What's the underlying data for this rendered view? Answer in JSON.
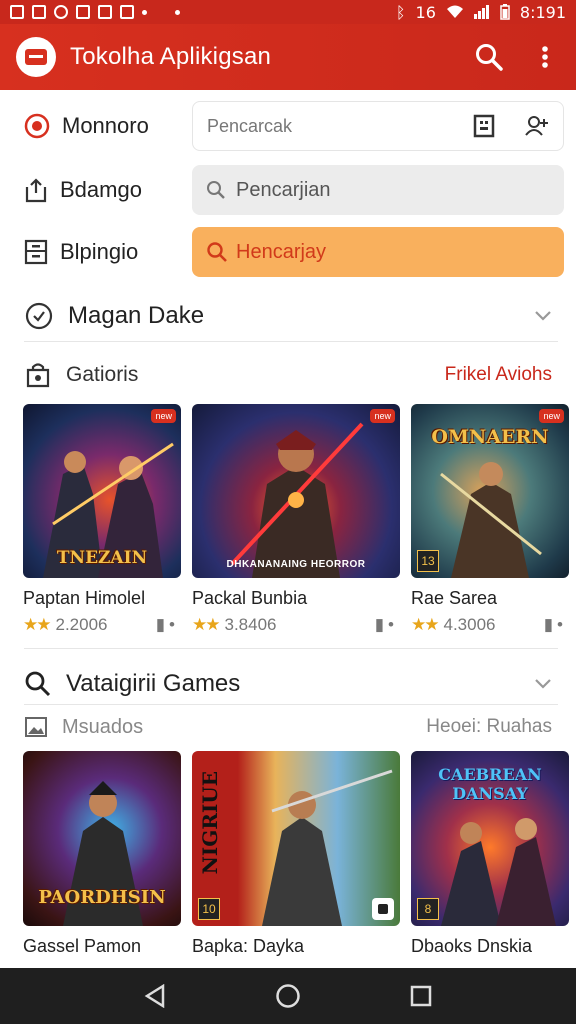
{
  "status_bar": {
    "time": "8:191",
    "network": "16"
  },
  "app_bar": {
    "title": "Tokolha Aplikigsan"
  },
  "filters": [
    {
      "label": "Monnoro",
      "field_text": "Pencarcak"
    },
    {
      "label": "Bdamgo",
      "field_text": "Pencarjian"
    },
    {
      "label": "Blpingio",
      "field_text": "Hencarjay"
    }
  ],
  "section1": {
    "title": "Magan Dake"
  },
  "section2": {
    "title": "Gatioris",
    "link": "Frikel Aviohs"
  },
  "cards_row1": [
    {
      "title": "Paptan Himolel",
      "rating": "2.2006",
      "caption": "TNEZAIN",
      "badge": "new"
    },
    {
      "title": "Packal Bunbia",
      "rating": "3.8406",
      "caption": "DHKANANAING HEORROR",
      "badge": "new"
    },
    {
      "title": "Rae Sarea",
      "rating": "4.3006",
      "caption": "OMNAERN",
      "badge": "new",
      "corner": "13"
    }
  ],
  "section3": {
    "title": "Vataigirii Games"
  },
  "section4": {
    "title": "Msuados",
    "right": "Heoei: Ruahas"
  },
  "cards_row2": [
    {
      "title": "Gassel Pamon",
      "caption": "PAORDHSIN"
    },
    {
      "title": "Bapka: Dayka",
      "caption": "NIGRIUE",
      "corner": "10"
    },
    {
      "title": "Dbaoks Dnskia",
      "caption": "CAEBREAN DANSAY",
      "corner": "8"
    }
  ],
  "colors": {
    "brand": "#d7301f",
    "accent_orange": "#f9b05d",
    "star": "#e8a51b"
  }
}
